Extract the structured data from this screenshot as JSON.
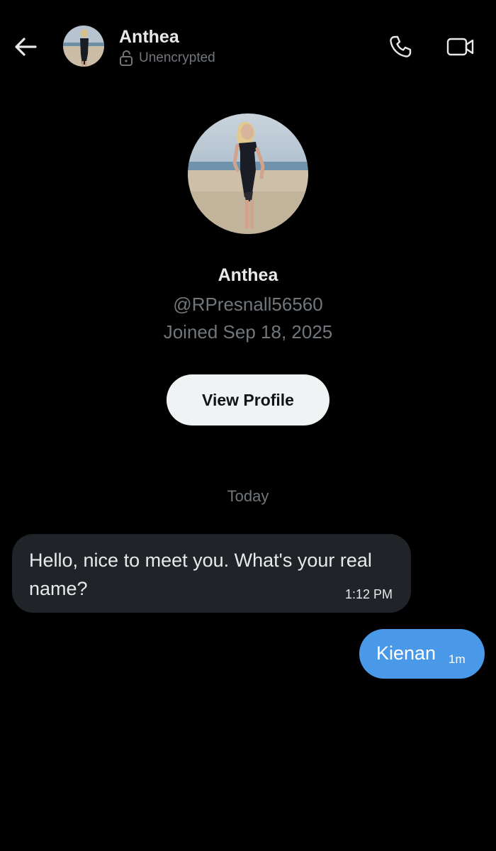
{
  "header": {
    "back_icon": "arrow-left-icon",
    "name": "Anthea",
    "encryption_status": "Unencrypted",
    "encryption_icon": "unlocked-padlock-icon",
    "call_icon": "phone-icon",
    "video_icon": "video-camera-icon"
  },
  "profile": {
    "name": "Anthea",
    "handle": "@RPresnall56560",
    "joined": "Joined Sep 18, 2025",
    "view_profile_label": "View Profile"
  },
  "conversation": {
    "date_divider": "Today",
    "messages": [
      {
        "direction": "incoming",
        "text": "Hello, nice to meet you. What's your real name?",
        "time": "1:12 PM"
      },
      {
        "direction": "outgoing",
        "text": "Kienan",
        "time": "1m"
      }
    ]
  },
  "colors": {
    "background": "#000000",
    "incoming_bubble": "#202327",
    "outgoing_bubble": "#4a99e9",
    "secondary_text": "#71767b",
    "button_bg": "#eff3f4"
  }
}
